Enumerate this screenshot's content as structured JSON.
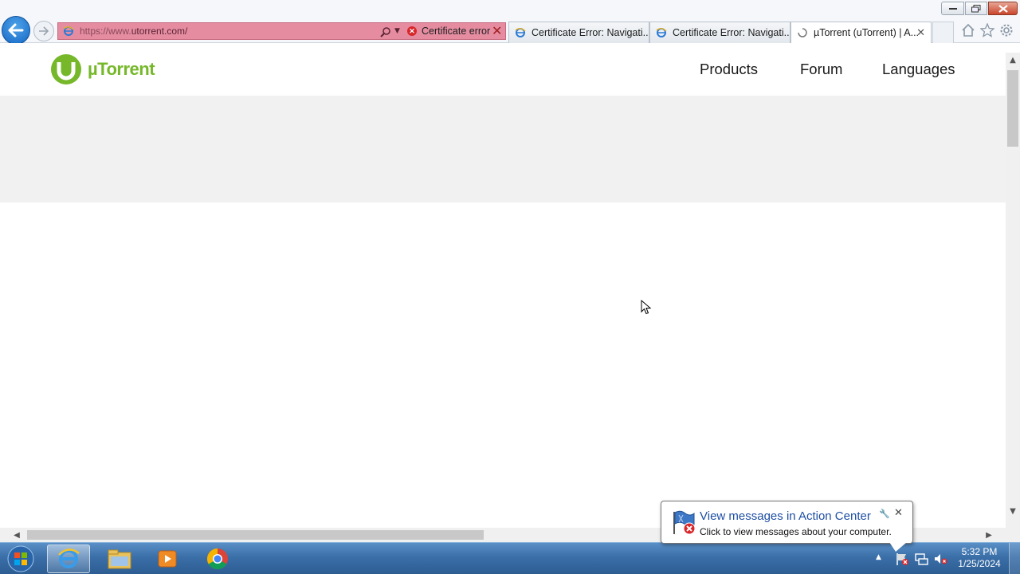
{
  "window": {
    "minimize_label": "",
    "maximize_label": "",
    "close_label": ""
  },
  "browser": {
    "address": {
      "url_prefix": "https://www.",
      "url_domain": "utorrent.com/",
      "certificate_status": "Certificate error"
    },
    "tabs": [
      {
        "label": "Certificate Error: Navigati...",
        "icon": "ie-page-icon"
      },
      {
        "label": "Certificate Error: Navigati...",
        "icon": "ie-page-icon"
      },
      {
        "label": "µTorrent (uTorrent) | A...",
        "icon": "loading-spinner-icon",
        "active": true
      }
    ]
  },
  "site": {
    "logo_text": "µTorrent",
    "brand_color": "#76b82a",
    "nav": {
      "products": "Products",
      "forum": "Forum",
      "languages": "Languages"
    }
  },
  "notification": {
    "title": "View messages in Action Center",
    "text": "Click to view messages about your computer."
  },
  "taskbar": {
    "apps": [
      "internet-explorer",
      "windows-explorer",
      "media-player",
      "chrome"
    ],
    "clock_time": "5:32 PM",
    "clock_date": "1/25/2024"
  },
  "colors": {
    "address_bar_error": "#e58ca1",
    "taskbar": "#3b6fa8",
    "hero_band": "#f1f1f1"
  }
}
